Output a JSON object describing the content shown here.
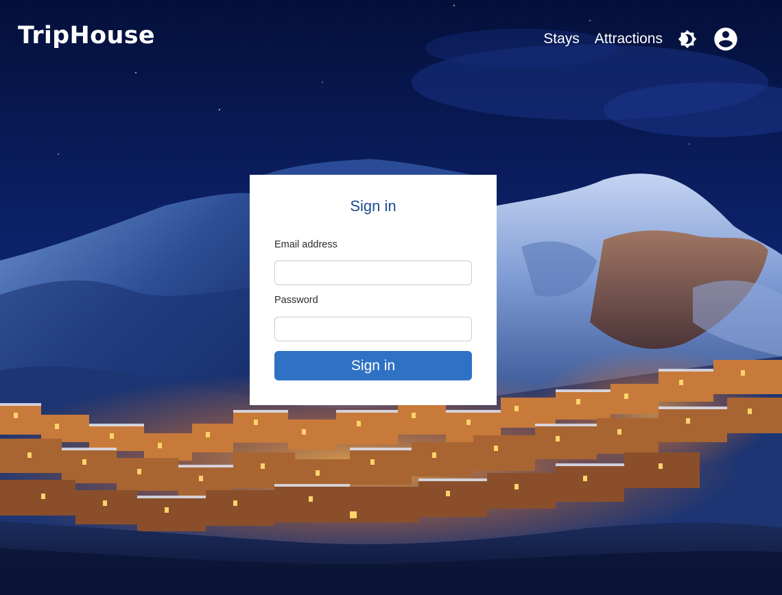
{
  "header": {
    "logo": "TripHouse",
    "nav": {
      "stays": "Stays",
      "attractions": "Attractions"
    },
    "icons": {
      "theme_toggle": "brightness-icon",
      "account": "account-circle-icon"
    }
  },
  "signin": {
    "title": "Sign in",
    "email_label": "Email address",
    "email_value": "",
    "password_label": "Password",
    "password_value": "",
    "submit_label": "Sign in"
  },
  "colors": {
    "accent": "#2f72c4",
    "title": "#1a4b8f",
    "sky": "#061442"
  }
}
